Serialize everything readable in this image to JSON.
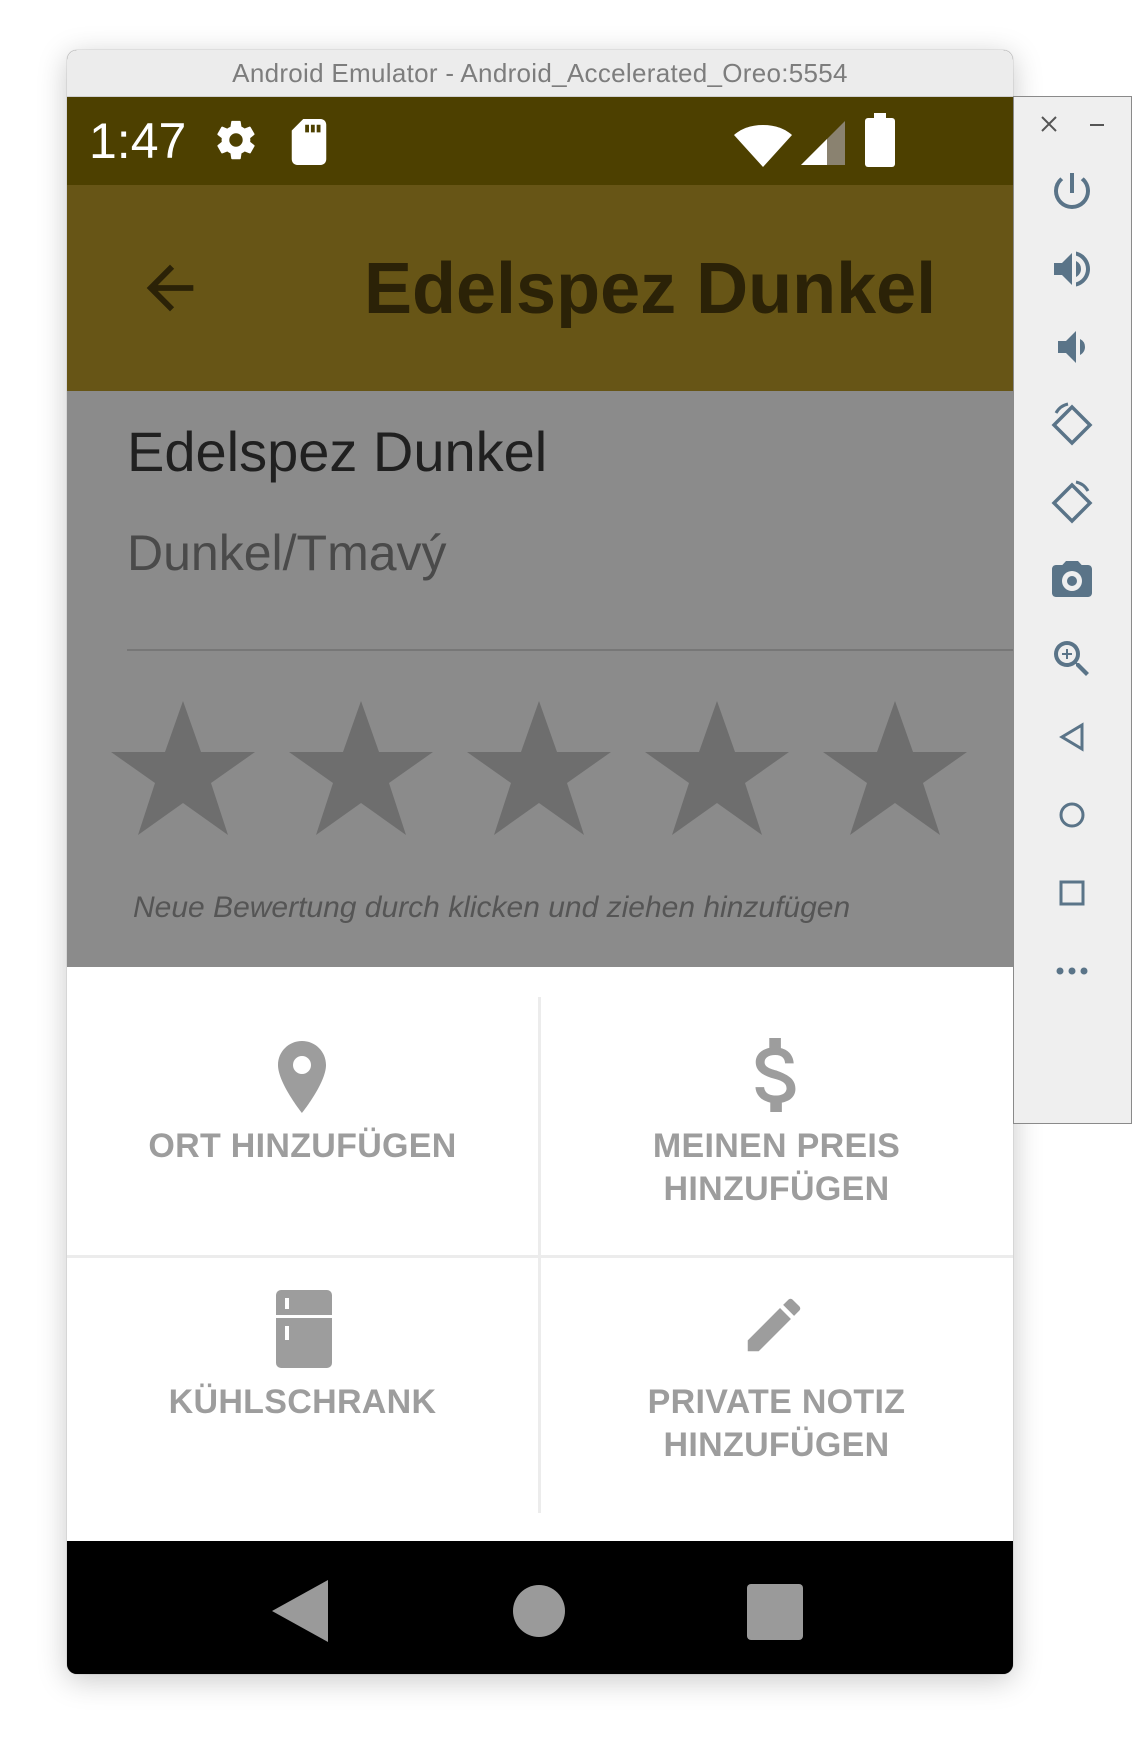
{
  "window": {
    "title": "Android Emulator - Android_Accelerated_Oreo:5554"
  },
  "statusbar": {
    "time": "1:47",
    "icons": [
      "settings-icon",
      "sd-card-icon",
      "wifi-icon",
      "signal-icon",
      "battery-icon"
    ]
  },
  "toolbar": {
    "title": "Edelspez Dunkel",
    "back_icon": "arrow-back-icon"
  },
  "beer": {
    "name": "Edelspez Dunkel",
    "style": "Dunkel/Tmavý",
    "rating_hint": "Neue Bewertung durch klicken und ziehen hinzufügen",
    "stars": 5
  },
  "actions": [
    {
      "icon": "location-pin-icon",
      "label_line1": "ORT HINZUFÜGEN",
      "label_line2": ""
    },
    {
      "icon": "dollar-icon",
      "label_line1": "MEINEN PREIS",
      "label_line2": "HINZUFÜGEN"
    },
    {
      "icon": "fridge-icon",
      "label_line1": "KÜHLSCHRANK",
      "label_line2": ""
    },
    {
      "icon": "pencil-icon",
      "label_line1": "PRIVATE NOTIZ",
      "label_line2": "HINZUFÜGEN"
    }
  ],
  "navbar": {
    "buttons": [
      "back-icon",
      "home-icon",
      "recents-icon"
    ]
  },
  "sidepanel": {
    "buttons": [
      "close-icon",
      "minimize-icon",
      "power-icon",
      "volume-up-icon",
      "volume-down-icon",
      "rotate-left-icon",
      "rotate-right-icon",
      "camera-icon",
      "zoom-icon",
      "back-icon",
      "home-icon",
      "overview-icon",
      "more-icon"
    ]
  },
  "colors": {
    "statusbar": "#4d4000",
    "toolbar": "#675516",
    "scrim": "#8b8b8b",
    "sheet_text": "#9d9d9d"
  }
}
